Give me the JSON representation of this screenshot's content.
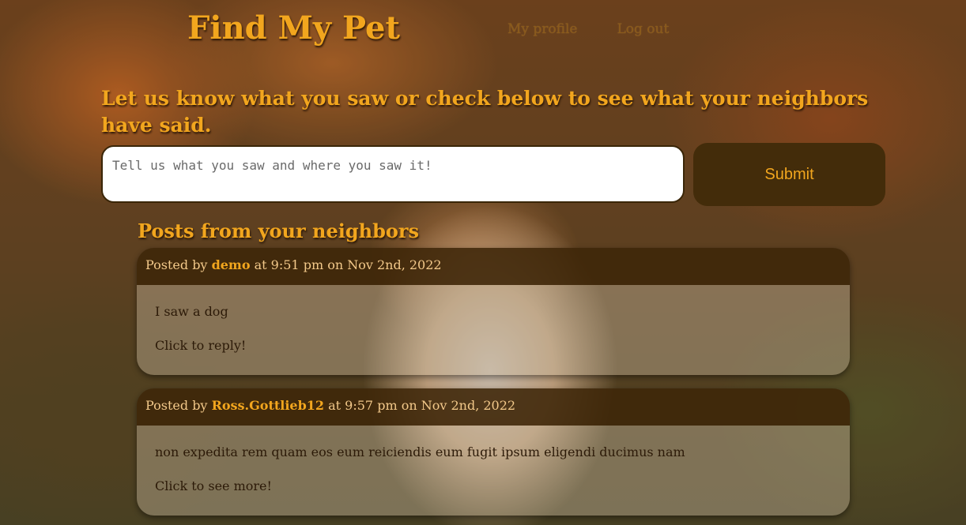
{
  "header": {
    "title": "Find My Pet",
    "nav": [
      "My profile",
      "Log out"
    ]
  },
  "form": {
    "prompt": "Let us know what you saw or check below to see what your neighbors have said.",
    "placeholder": "Tell us what you saw and where you saw it!",
    "submit_label": "Submit"
  },
  "posts": {
    "heading": "Posts from your neighbors",
    "items": [
      {
        "posted_by_label": "Posted by",
        "author": "demo",
        "timestamp": "at 9:51 pm on Nov 2nd, 2022",
        "body": "I saw a dog",
        "action": "Click to reply!"
      },
      {
        "posted_by_label": "Posted by",
        "author": "Ross.Gottlieb12",
        "timestamp": "at 9:57 pm on Nov 2nd, 2022",
        "body": "non expedita rem quam eos eum reiciendis eum fugit ipsum eligendi ducimus nam",
        "action": "Click to see more!"
      }
    ]
  },
  "colors": {
    "accent": "#f2a61e",
    "dark_brown": "#432c0a"
  }
}
